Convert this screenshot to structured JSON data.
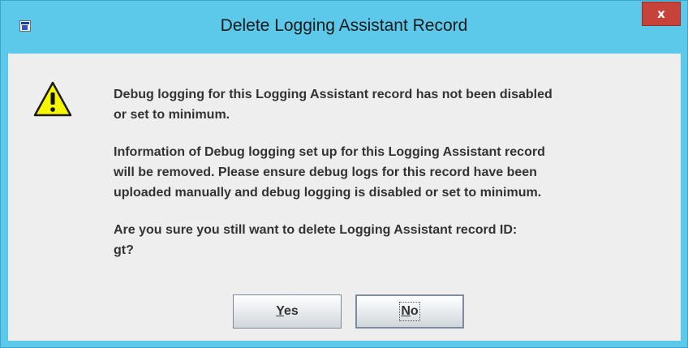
{
  "window": {
    "title": "Delete Logging Assistant Record",
    "close_label": "x",
    "icons": {
      "app": "application-icon",
      "close": "close-icon"
    }
  },
  "dialog": {
    "icon": "warning-icon",
    "paragraphs": [
      "Debug logging for this Logging Assistant record has not been disabled\nor set to minimum.",
      "Information of Debug logging set up for this Logging Assistant record\nwill be removed. Please ensure debug logs for this record have been\nuploaded manually and debug logging is disabled or set to minimum.",
      "Are you sure you still want to delete Logging Assistant record ID:\ngt?"
    ]
  },
  "buttons": {
    "yes": {
      "mnemonic": "Y",
      "rest": "es"
    },
    "no": {
      "mnemonic": "N",
      "rest": "o"
    }
  },
  "colors": {
    "titlebar": "#5cc8ea",
    "close": "#c7433a",
    "client": "#eeeeee",
    "warning_fill": "#f5f500"
  }
}
